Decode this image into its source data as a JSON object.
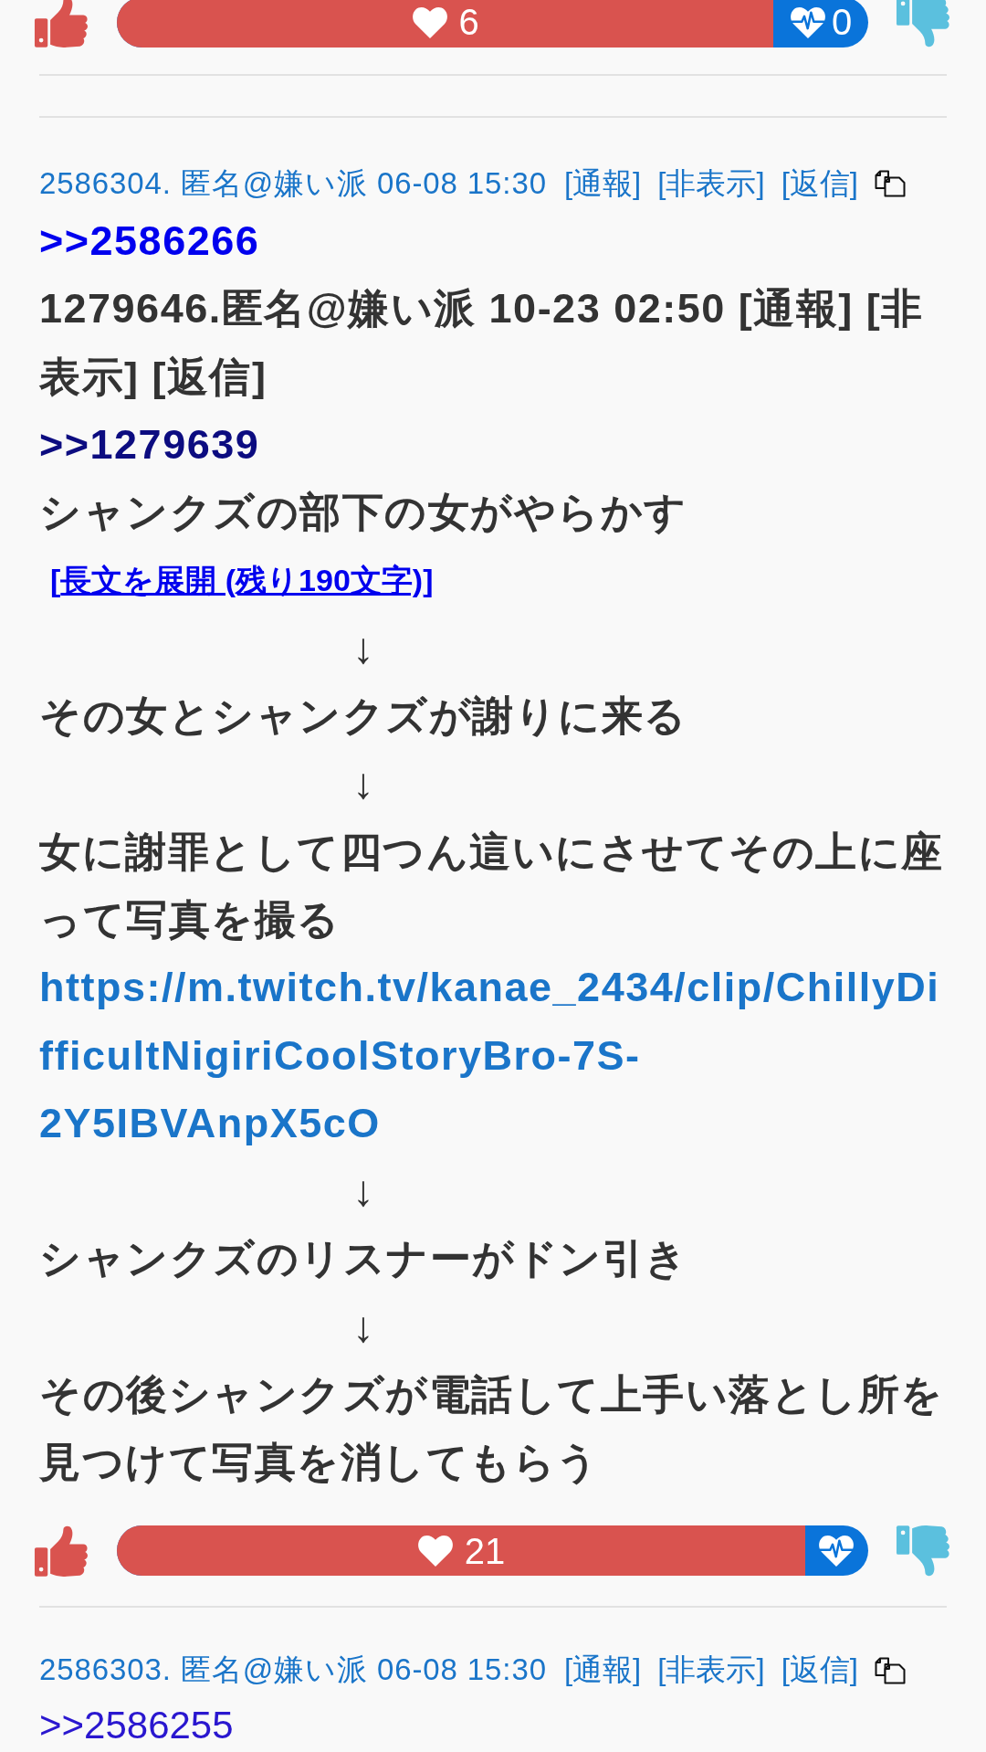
{
  "previous_post": {
    "votes": {
      "likes": "6",
      "dislikes": "0",
      "level": 0.874
    }
  },
  "posts": [
    {
      "header": {
        "meta": "2586304. 匿名@嫌い派 06-08 15:30",
        "actions": [
          "[通報]",
          "[非表示]",
          "[返信]"
        ]
      },
      "lines": [
        {
          "kind": "anchor",
          "text": ">>2586266",
          "visited": false
        },
        {
          "kind": "text",
          "text": "1279646.匿名@嫌い派 10-23 02:50 [通報] [非表示] [返信]"
        },
        {
          "kind": "quoted",
          "text": ">>1279639"
        },
        {
          "kind": "text",
          "text": "シャンクズの部下の女がやらかす"
        },
        {
          "kind": "expand",
          "open": "[",
          "text": "長文を展開 (残り190文字)",
          "close": "]"
        },
        {
          "kind": "arrow",
          "text": "↓"
        },
        {
          "kind": "text",
          "text": "その女とシャンクズが謝りに来る"
        },
        {
          "kind": "arrow",
          "text": "↓"
        },
        {
          "kind": "text",
          "text": "女に謝罪として四つん這いにさせてその上に座って写真を撮る"
        },
        {
          "kind": "url",
          "text": "https://m.twitch.tv/kanae_2434/clip/ChillyDifficultNigiriCoolStoryBro-7S-2Y5IBVAnpX5cO"
        },
        {
          "kind": "arrow",
          "text": "↓"
        },
        {
          "kind": "text",
          "text": "シャンクズのリスナーがドン引き"
        },
        {
          "kind": "arrow",
          "text": "↓"
        },
        {
          "kind": "text",
          "text": "その後シャンクズが電話して上手い落とし所を見つけて写真を消してもらう"
        }
      ],
      "votes": {
        "likes": "21",
        "level": 0.916
      }
    },
    {
      "header": {
        "meta": "2586303. 匿名@嫌い派 06-08 15:30",
        "actions": [
          "[通報]",
          "[非表示]",
          "[返信]"
        ]
      },
      "lines": [
        {
          "kind": "anchor",
          "text": ">>2586255",
          "visited": true
        }
      ]
    }
  ]
}
